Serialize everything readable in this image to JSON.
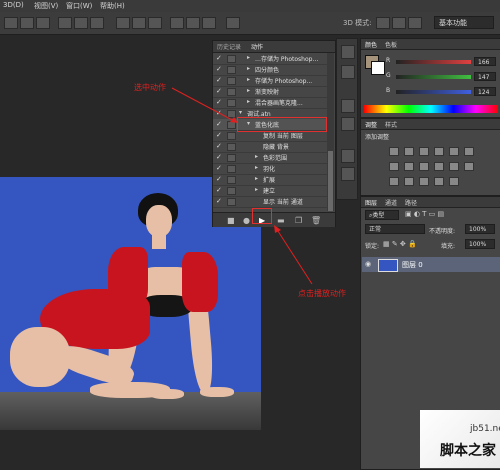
{
  "menubar": {
    "items": [
      "3D(D)",
      "视图(V)",
      "窗口(W)",
      "帮助(H)"
    ]
  },
  "optbar": {
    "mode_label": "3D 模式:",
    "workspace": "基本功能"
  },
  "actions_panel": {
    "tabs": [
      "历史记录",
      "动作"
    ],
    "rows": [
      {
        "check": "✓",
        "arrow": "▸",
        "label": "…存储为 Photoshop…",
        "indent": 2
      },
      {
        "check": "✓",
        "arrow": "▸",
        "label": "四分颜色",
        "indent": 2
      },
      {
        "check": "✓",
        "arrow": "▸",
        "label": "存储为 Photoshop...",
        "indent": 2
      },
      {
        "check": "✓",
        "arrow": "▸",
        "label": "渐变映射",
        "indent": 2
      },
      {
        "check": "✓",
        "arrow": "▸",
        "label": "混合器画笔克隆...",
        "indent": 2
      },
      {
        "check": "✓",
        "arrow": "▾",
        "label": "调试.atn",
        "indent": 1
      },
      {
        "check": "✓",
        "arrow": "▾",
        "label": "蓝色化底",
        "indent": 2
      },
      {
        "check": "✓",
        "arrow": "",
        "label": "复制 当前 图层",
        "indent": 3
      },
      {
        "check": "✓",
        "arrow": "",
        "label": "隐藏 背景",
        "indent": 3
      },
      {
        "check": "✓",
        "arrow": "▸",
        "label": "色彩范围",
        "indent": 3
      },
      {
        "check": "✓",
        "arrow": "▸",
        "label": "羽化",
        "indent": 3
      },
      {
        "check": "✓",
        "arrow": "▸",
        "label": "扩展",
        "indent": 3
      },
      {
        "check": "✓",
        "arrow": "▸",
        "label": "建立",
        "indent": 3
      },
      {
        "check": "✓",
        "arrow": "",
        "label": "显示 当前 通道",
        "indent": 3
      }
    ],
    "bottom_buttons": [
      "■",
      "●",
      "▶",
      "▬",
      "❐",
      "🗑"
    ]
  },
  "annotations": {
    "select_action": "选中动作",
    "click_play": "点击播放动作"
  },
  "color_panel": {
    "tabs": [
      "颜色",
      "色板"
    ],
    "channels": [
      {
        "label": "R",
        "value": "166",
        "color": "#e04040"
      },
      {
        "label": "G",
        "value": "147",
        "color": "#40c040"
      },
      {
        "label": "B",
        "value": "124",
        "color": "#4060e0"
      }
    ]
  },
  "adjustments_panel": {
    "tabs": [
      "调整",
      "样式"
    ],
    "title": "添加调整"
  },
  "layers_panel": {
    "tabs": [
      "图层",
      "通道",
      "路径"
    ],
    "kind_filter": "类型",
    "blend_mode": "正常",
    "opacity_label": "不透明度:",
    "opacity_value": "100%",
    "lock_label": "锁定:",
    "fill_label": "填充:",
    "fill_value": "100%",
    "layer_name": "图层 0"
  },
  "watermark": {
    "text": "脚本之家",
    "url": "jb51.net"
  }
}
